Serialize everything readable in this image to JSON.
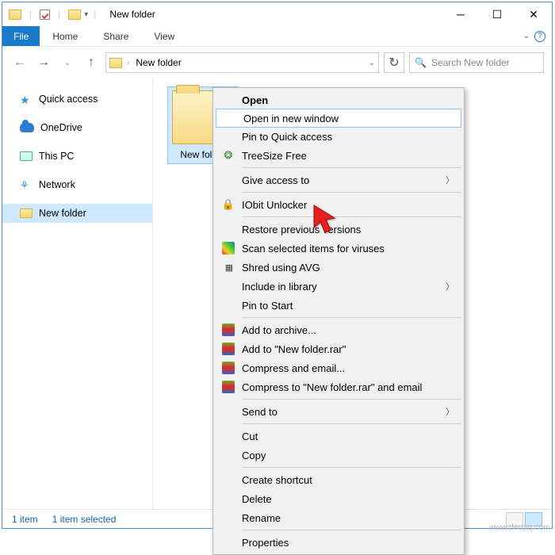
{
  "window": {
    "title": "New folder"
  },
  "ribbon": {
    "file": "File",
    "home": "Home",
    "share": "Share",
    "view": "View"
  },
  "address": {
    "crumb": "New folder",
    "search_placeholder": "Search New folder"
  },
  "nav": {
    "quick_access": "Quick access",
    "onedrive": "OneDrive",
    "this_pc": "This PC",
    "network": "Network",
    "new_folder": "New folder"
  },
  "content": {
    "folder_label": "New folder"
  },
  "context_menu": {
    "open": "Open",
    "open_new_window": "Open in new window",
    "pin_quick": "Pin to Quick access",
    "treesize": "TreeSize Free",
    "give_access": "Give access to",
    "iobit": "IObit Unlocker",
    "restore": "Restore previous versions",
    "scan_virus": "Scan selected items for viruses",
    "shred": "Shred using AVG",
    "include_lib": "Include in library",
    "pin_start": "Pin to Start",
    "add_archive": "Add to archive...",
    "add_rar": "Add to \"New folder.rar\"",
    "compress_email": "Compress and email...",
    "compress_rar_email": "Compress to \"New folder.rar\" and email",
    "send_to": "Send to",
    "cut": "Cut",
    "copy": "Copy",
    "create_shortcut": "Create shortcut",
    "delete": "Delete",
    "rename": "Rename",
    "properties": "Properties"
  },
  "status": {
    "count": "1 item",
    "selected": "1 item selected"
  },
  "watermark": "www.deuaq.com"
}
